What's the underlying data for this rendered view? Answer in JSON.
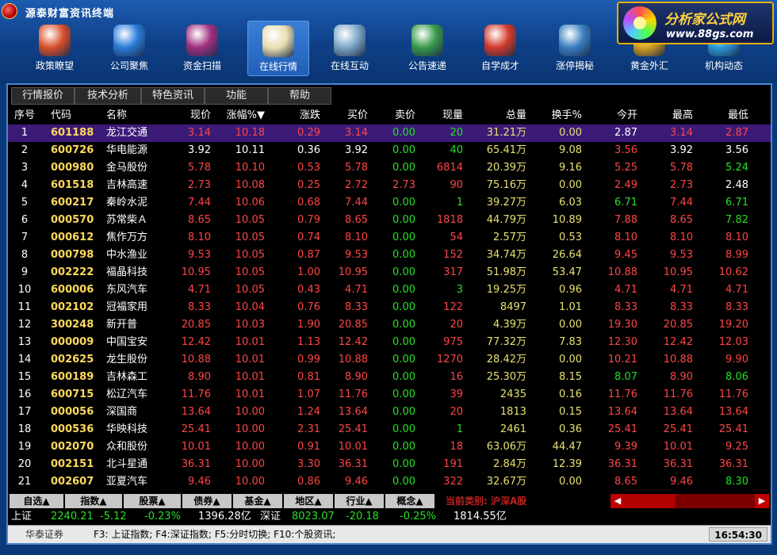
{
  "app": {
    "title": "源泰财富资讯终端"
  },
  "brand": {
    "name": "分析家公式网",
    "url": "www.88gs.com"
  },
  "nav": [
    {
      "label": "政策瞭望",
      "icon": "policy-icon",
      "color": "#d9502a"
    },
    {
      "label": "公司聚焦",
      "icon": "lightning-icon",
      "color": "#2a7cd9"
    },
    {
      "label": "资金扫描",
      "icon": "scan-icon",
      "color": "#a03080"
    },
    {
      "label": "在线行情",
      "icon": "scroll-icon",
      "color": "#e8dcb0"
    },
    {
      "label": "在线互动",
      "icon": "people-icon",
      "color": "#7fa6c8"
    },
    {
      "label": "公告速递",
      "icon": "dvd-icon",
      "color": "#3a9a4a"
    },
    {
      "label": "自学成才",
      "icon": "star-icon",
      "color": "#d33a2a"
    },
    {
      "label": "涨停揭秘",
      "icon": "bars-icon",
      "color": "#3a7fc0"
    },
    {
      "label": "黄金外汇",
      "icon": "gold-icon",
      "color": "#d9a020"
    },
    {
      "label": "机构动态",
      "icon": "globe-icon",
      "color": "#2a9ad9"
    }
  ],
  "menu": [
    "行情报价",
    "技术分析",
    "特色资讯",
    "功能",
    "帮助"
  ],
  "columns": {
    "idx": "序号",
    "code": "代码",
    "name": "名称",
    "price": "现价",
    "pct": "涨幅%▼",
    "chg": "涨跌",
    "bid": "买价",
    "ask": "卖价",
    "vol": "现量",
    "total": "总量",
    "turn": "换手%",
    "open": "今开",
    "high": "最高",
    "low": "最低"
  },
  "rows": [
    [
      "1",
      "601188",
      "龙江交通",
      "3.14",
      "10.18",
      "0.29",
      "3.14",
      "0.00",
      "20",
      "31.21万",
      "0.00",
      "2.87",
      "3.14",
      "2.87"
    ],
    [
      "2",
      "600726",
      "华电能源",
      "3.92",
      "10.11",
      "0.36",
      "3.92",
      "0.00",
      "40",
      "65.41万",
      "9.08",
      "3.56",
      "3.92",
      "3.56"
    ],
    [
      "3",
      "000980",
      "金马股份",
      "5.78",
      "10.10",
      "0.53",
      "5.78",
      "0.00",
      "6814",
      "20.39万",
      "9.16",
      "5.25",
      "5.78",
      "5.24"
    ],
    [
      "4",
      "601518",
      "吉林高速",
      "2.73",
      "10.08",
      "0.25",
      "2.72",
      "2.73",
      "90",
      "75.16万",
      "0.00",
      "2.49",
      "2.73",
      "2.48"
    ],
    [
      "5",
      "600217",
      "秦岭水泥",
      "7.44",
      "10.06",
      "0.68",
      "7.44",
      "0.00",
      "1",
      "39.27万",
      "6.03",
      "6.71",
      "7.44",
      "6.71"
    ],
    [
      "6",
      "000570",
      "苏常柴Ａ",
      "8.65",
      "10.05",
      "0.79",
      "8.65",
      "0.00",
      "1818",
      "44.79万",
      "10.89",
      "7.88",
      "8.65",
      "7.82"
    ],
    [
      "7",
      "000612",
      "焦作万方",
      "8.10",
      "10.05",
      "0.74",
      "8.10",
      "0.00",
      "54",
      "2.57万",
      "0.53",
      "8.10",
      "8.10",
      "8.10"
    ],
    [
      "8",
      "000798",
      "中水渔业",
      "9.53",
      "10.05",
      "0.87",
      "9.53",
      "0.00",
      "152",
      "34.74万",
      "26.64",
      "9.45",
      "9.53",
      "8.99"
    ],
    [
      "9",
      "002222",
      "福晶科技",
      "10.95",
      "10.05",
      "1.00",
      "10.95",
      "0.00",
      "317",
      "51.98万",
      "53.47",
      "10.88",
      "10.95",
      "10.62"
    ],
    [
      "10",
      "600006",
      "东风汽车",
      "4.71",
      "10.05",
      "0.43",
      "4.71",
      "0.00",
      "3",
      "19.25万",
      "0.96",
      "4.71",
      "4.71",
      "4.71"
    ],
    [
      "11",
      "002102",
      "冠福家用",
      "8.33",
      "10.04",
      "0.76",
      "8.33",
      "0.00",
      "122",
      "8497",
      "1.01",
      "8.33",
      "8.33",
      "8.33"
    ],
    [
      "12",
      "300248",
      "新开普",
      "20.85",
      "10.03",
      "1.90",
      "20.85",
      "0.00",
      "20",
      "4.39万",
      "0.00",
      "19.30",
      "20.85",
      "19.20"
    ],
    [
      "13",
      "000009",
      "中国宝安",
      "12.42",
      "10.01",
      "1.13",
      "12.42",
      "0.00",
      "975",
      "77.32万",
      "7.83",
      "12.30",
      "12.42",
      "12.03"
    ],
    [
      "14",
      "002625",
      "龙生股份",
      "10.88",
      "10.01",
      "0.99",
      "10.88",
      "0.00",
      "1270",
      "28.42万",
      "0.00",
      "10.21",
      "10.88",
      "9.90"
    ],
    [
      "15",
      "600189",
      "吉林森工",
      "8.90",
      "10.01",
      "0.81",
      "8.90",
      "0.00",
      "16",
      "25.30万",
      "8.15",
      "8.07",
      "8.90",
      "8.06"
    ],
    [
      "16",
      "600715",
      "松辽汽车",
      "11.76",
      "10.01",
      "1.07",
      "11.76",
      "0.00",
      "39",
      "2435",
      "0.16",
      "11.76",
      "11.76",
      "11.76"
    ],
    [
      "17",
      "000056",
      "深国商",
      "13.64",
      "10.00",
      "1.24",
      "13.64",
      "0.00",
      "20",
      "1813",
      "0.15",
      "13.64",
      "13.64",
      "13.64"
    ],
    [
      "18",
      "000536",
      "华映科技",
      "25.41",
      "10.00",
      "2.31",
      "25.41",
      "0.00",
      "1",
      "2461",
      "0.36",
      "25.41",
      "25.41",
      "25.41"
    ],
    [
      "19",
      "002070",
      "众和股份",
      "10.01",
      "10.00",
      "0.91",
      "10.01",
      "0.00",
      "18",
      "63.06万",
      "44.47",
      "9.39",
      "10.01",
      "9.25"
    ],
    [
      "20",
      "002151",
      "北斗星通",
      "36.31",
      "10.00",
      "3.30",
      "36.31",
      "0.00",
      "191",
      "2.84万",
      "12.39",
      "36.31",
      "36.31",
      "36.31"
    ],
    [
      "21",
      "002607",
      "亚夏汽车",
      "9.46",
      "10.00",
      "0.86",
      "9.46",
      "0.00",
      "322",
      "32.67万",
      "0.00",
      "8.65",
      "9.46",
      "8.30"
    ]
  ],
  "row_colors": [
    [
      "red",
      "white",
      "red",
      "red",
      "red"
    ],
    [
      "white",
      "red",
      "white",
      "white",
      "white"
    ],
    [
      "red",
      "red",
      "red",
      "red",
      "green"
    ],
    [
      "red",
      "red",
      "red",
      "red",
      "white"
    ],
    [
      "red",
      "green",
      "red",
      "red",
      "green"
    ],
    [
      "red",
      "red",
      "red",
      "red",
      "green"
    ],
    [
      "red",
      "red",
      "red",
      "red",
      "red"
    ],
    [
      "red",
      "red",
      "red",
      "red",
      "red"
    ],
    [
      "red",
      "red",
      "red",
      "red",
      "red"
    ],
    [
      "red",
      "red",
      "red",
      "red",
      "red"
    ],
    [
      "red",
      "red",
      "red",
      "red",
      "red"
    ],
    [
      "red",
      "red",
      "red",
      "red",
      "red"
    ],
    [
      "red",
      "red",
      "red",
      "red",
      "red"
    ],
    [
      "red",
      "red",
      "red",
      "red",
      "red"
    ],
    [
      "red",
      "green",
      "red",
      "red",
      "green"
    ],
    [
      "red",
      "red",
      "red",
      "red",
      "red"
    ],
    [
      "red",
      "red",
      "red",
      "red",
      "red"
    ],
    [
      "red",
      "red",
      "red",
      "red",
      "red"
    ],
    [
      "red",
      "red",
      "red",
      "red",
      "red"
    ],
    [
      "red",
      "red",
      "red",
      "red",
      "red"
    ],
    [
      "red",
      "red",
      "red",
      "red",
      "green"
    ]
  ],
  "tabs": [
    "自选▲",
    "指数▲",
    "股票▲",
    "债券▲",
    "基金▲",
    "地区▲",
    "行业▲",
    "概念▲"
  ],
  "category": "当前类别: 沪深A股",
  "index_bar": {
    "sh_label": "上证",
    "sh_value": "2240.21",
    "sh_change": "-5.12",
    "sh_pct": "-0.23%",
    "sh_amount": "1396.28亿",
    "sz_label": "深证",
    "sz_value": "8023.07",
    "sz_change": "-20.18",
    "sz_pct": "-0.25%",
    "sz_amount": "1814.55亿"
  },
  "status": {
    "broker": "华泰证券",
    "shortcuts": "F3: 上证指数; F4:深证指数; F5:分时切换; F10:个股资讯;",
    "time": "16:54:30"
  }
}
